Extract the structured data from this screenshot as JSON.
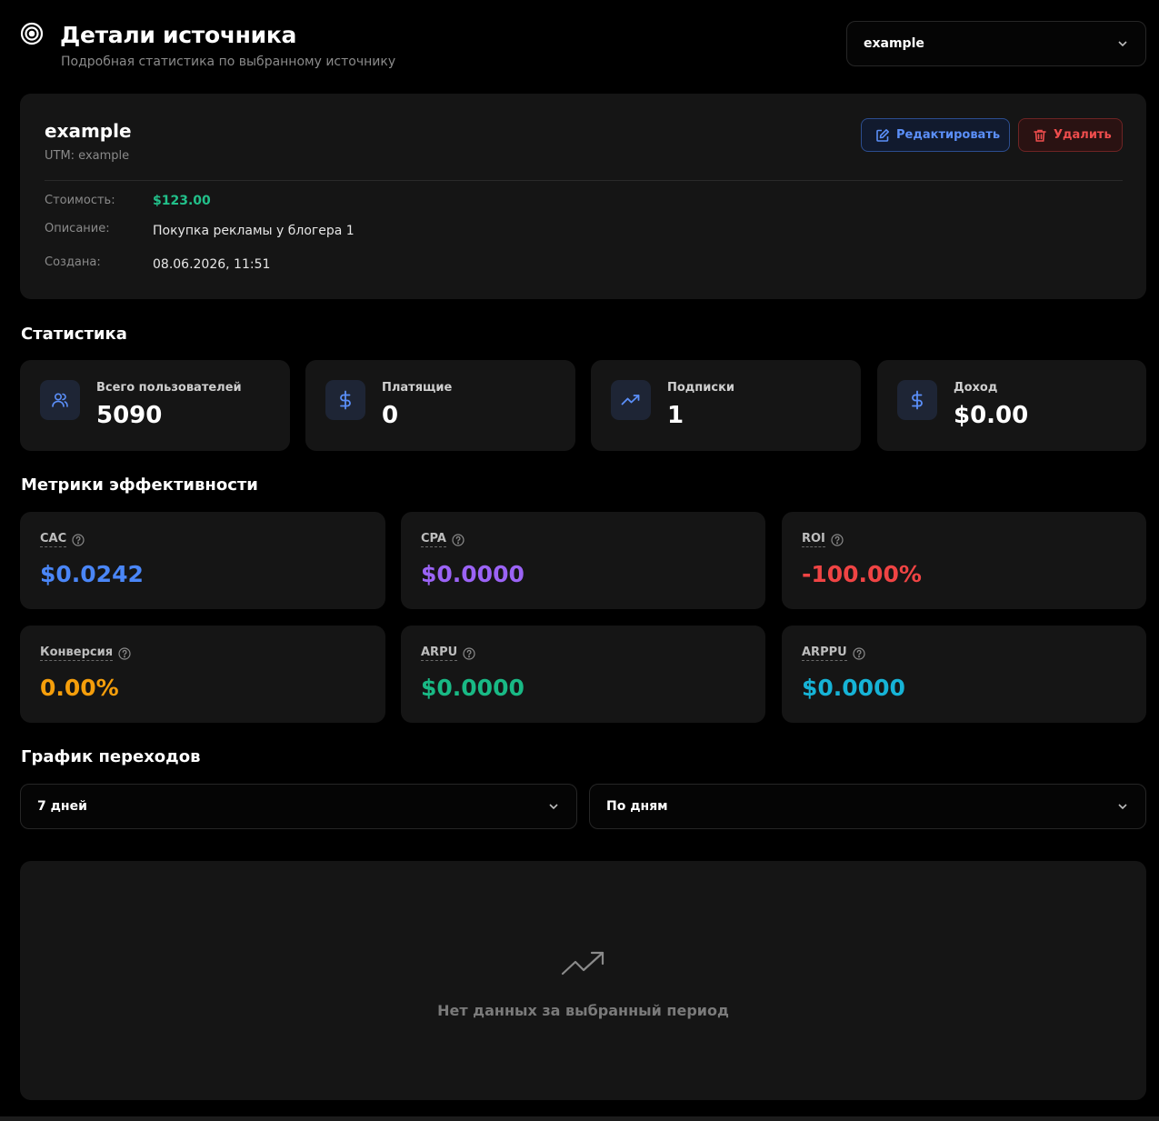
{
  "header": {
    "title": "Детали источника",
    "subtitle": "Подробная статистика по выбранному источнику",
    "icon": "target-icon",
    "source_select_value": "example"
  },
  "source": {
    "name": "example",
    "utm": "UTM: example",
    "edit_label": "Редактировать",
    "delete_label": "Удалить",
    "cost_label": "Стоимость:",
    "cost_value": "$123.00",
    "description_label": "Описание:",
    "description_value": "Покупка рекламы у блогера 1",
    "created_label": "Создана:",
    "created_value": "08.06.2026, 11:51"
  },
  "statistics": {
    "title": "Статистика",
    "cards": [
      {
        "label": "Всего пользователей",
        "value": "5090",
        "icon": "users-icon"
      },
      {
        "label": "Платящие",
        "value": "0",
        "icon": "dollar-icon"
      },
      {
        "label": "Подписки",
        "value": "1",
        "icon": "trending-up-icon"
      },
      {
        "label": "Доход",
        "value": "$0.00",
        "icon": "dollar-icon"
      }
    ]
  },
  "metrics": {
    "title": "Метрики эффективности",
    "cards": [
      {
        "label": "CAC",
        "value": "$0.0242",
        "color": "#4a86f7"
      },
      {
        "label": "CPA",
        "value": "$0.0000",
        "color": "#9b63f5"
      },
      {
        "label": "ROI",
        "value": "-100.00%",
        "color": "#ef4444"
      },
      {
        "label": "Конверсия",
        "value": "0.00%",
        "color": "#f59e0b"
      },
      {
        "label": "ARPU",
        "value": "$0.0000",
        "color": "#19b985"
      },
      {
        "label": "ARPPU",
        "value": "$0.0000",
        "color": "#16b3d6"
      }
    ]
  },
  "chart": {
    "title": "График переходов",
    "period_value": "7 дней",
    "grouping_value": "По дням",
    "empty_text": "Нет данных за выбранный период"
  }
}
